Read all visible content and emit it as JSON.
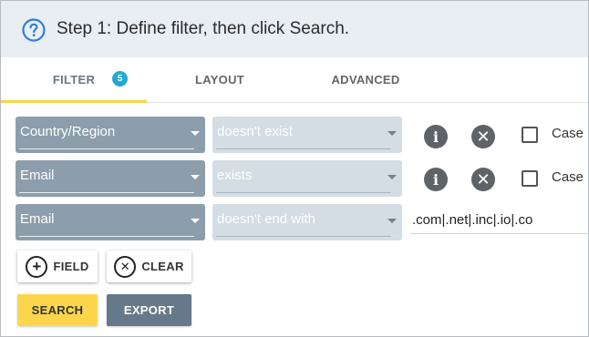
{
  "header": {
    "title": "Step 1: Define filter, then click Search.",
    "help_icon": "help-circle-icon"
  },
  "tabs": [
    {
      "label": "FILTER",
      "badge": "5",
      "active": true
    },
    {
      "label": "LAYOUT",
      "active": false
    },
    {
      "label": "ADVANCED",
      "active": false
    }
  ],
  "filters": [
    {
      "field": "Country/Region",
      "operator": "doesn't exist",
      "case_label": "Case",
      "case_checked": false
    },
    {
      "field": "Email",
      "operator": "exists",
      "case_label": "Case",
      "case_checked": false
    },
    {
      "field": "Email",
      "operator": "doesn't end with",
      "value": ".com|.net|.inc|.io|.co"
    }
  ],
  "buttons": {
    "add_field": "FIELD",
    "clear": "CLEAR",
    "search": "SEARCH",
    "export": "EXPORT"
  },
  "colors": {
    "accent_yellow": "#fdd64c",
    "badge_blue": "#26a8d0",
    "field_select": "#8c9eab",
    "export_button": "#65798a"
  }
}
